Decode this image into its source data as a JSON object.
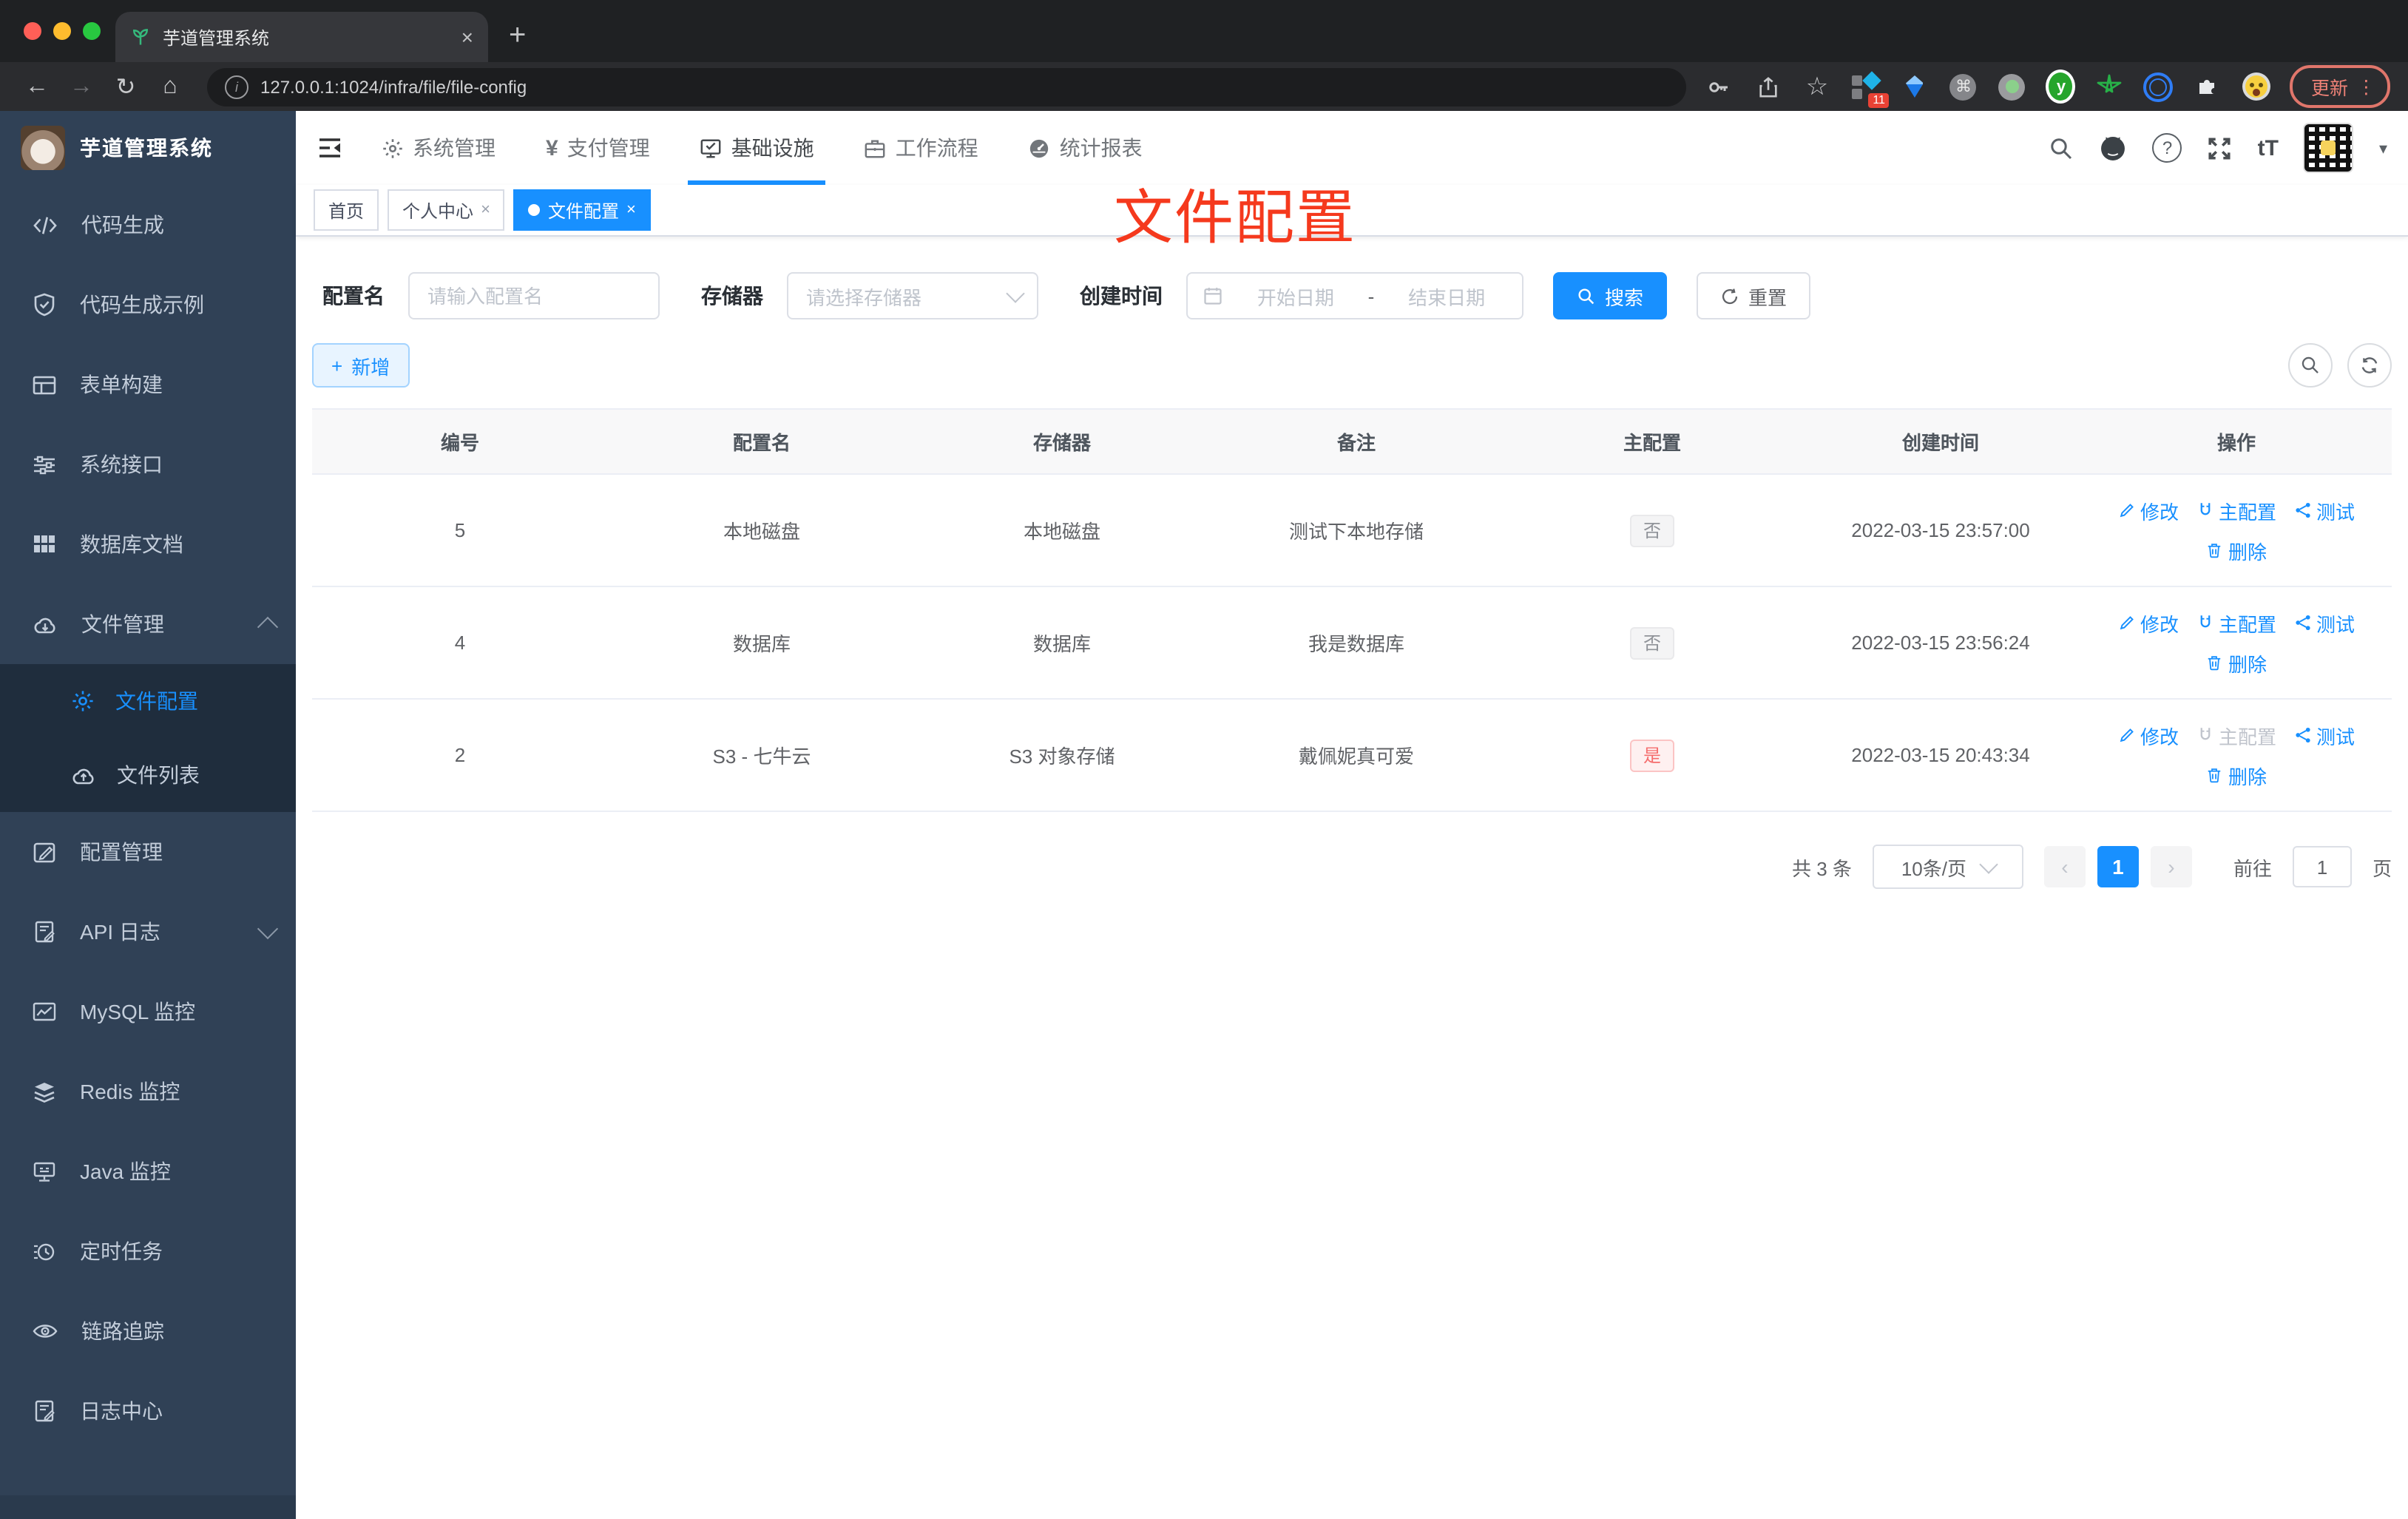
{
  "browser": {
    "tab_title": "芋道管理系统",
    "url": "127.0.0.1:1024/infra/file/file-config",
    "update_label": "更新",
    "ext_badge": "11",
    "ext_y": "y"
  },
  "icons": {
    "back": "←",
    "forward": "→",
    "reload": "↻",
    "home": "⌂",
    "star": "☆",
    "command": "⌘",
    "info": "i",
    "question": "?",
    "font_resize": "tT",
    "caret_down": "▾",
    "close": "×",
    "plus": "+",
    "ellipsis_v": "⋮",
    "prev": "‹",
    "next": "›"
  },
  "sidebar": {
    "title": "芋道管理系统",
    "items": [
      {
        "label": "代码生成"
      },
      {
        "label": "代码生成示例"
      },
      {
        "label": "表单构建"
      },
      {
        "label": "系统接口"
      },
      {
        "label": "数据库文档"
      },
      {
        "label": "文件管理",
        "expanded": true,
        "children": [
          {
            "label": "文件配置",
            "active": true
          },
          {
            "label": "文件列表"
          }
        ]
      },
      {
        "label": "配置管理"
      },
      {
        "label": "API 日志",
        "collapsed": true
      },
      {
        "label": "MySQL 监控"
      },
      {
        "label": "Redis 监控"
      },
      {
        "label": "Java 监控"
      },
      {
        "label": "定时任务"
      },
      {
        "label": "链路追踪"
      },
      {
        "label": "日志中心"
      }
    ]
  },
  "topnav": {
    "items": [
      {
        "label": "系统管理"
      },
      {
        "label": "支付管理"
      },
      {
        "label": "基础设施",
        "active": true
      },
      {
        "label": "工作流程"
      },
      {
        "label": "统计报表"
      }
    ]
  },
  "tags": {
    "items": [
      {
        "label": "首页"
      },
      {
        "label": "个人中心",
        "closable": true
      },
      {
        "label": "文件配置",
        "closable": true,
        "active": true
      }
    ]
  },
  "annotation": {
    "text": "文件配置"
  },
  "filters": {
    "name_label": "配置名",
    "name_placeholder": "请输入配置名",
    "storage_label": "存储器",
    "storage_placeholder": "请选择存储器",
    "time_label": "创建时间",
    "start_placeholder": "开始日期",
    "range_separator": "-",
    "end_placeholder": "结束日期",
    "search_label": "搜索",
    "reset_label": "重置"
  },
  "toolbar": {
    "add_label": "新增"
  },
  "table": {
    "headers": [
      "编号",
      "配置名",
      "存储器",
      "备注",
      "主配置",
      "创建时间",
      "操作"
    ],
    "actions": {
      "edit": "修改",
      "master": "主配置",
      "test": "测试",
      "del": "删除"
    },
    "rows": [
      {
        "id": "5",
        "name": "本地磁盘",
        "storage": "本地磁盘",
        "remark": "测试下本地存储",
        "primary": "否",
        "primary_type": "info",
        "created": "2022-03-15 23:57:00",
        "master_disabled": false
      },
      {
        "id": "4",
        "name": "数据库",
        "storage": "数据库",
        "remark": "我是数据库",
        "primary": "否",
        "primary_type": "info",
        "created": "2022-03-15 23:56:24",
        "master_disabled": false
      },
      {
        "id": "2",
        "name": "S3 - 七牛云",
        "storage": "S3 对象存储",
        "remark": "戴佩妮真可爱",
        "primary": "是",
        "primary_type": "danger",
        "created": "2022-03-15 20:43:34",
        "master_disabled": true
      }
    ]
  },
  "pagination": {
    "total": "共 3 条",
    "size": "10条/页",
    "page": "1",
    "goto_label": "前往",
    "goto_value": "1",
    "unit": "页"
  },
  "colors": {
    "primary": "#1890ff",
    "annotation_red": "#f5391d",
    "sidebar_bg": "#304156",
    "submenu_bg": "#1f2d3d",
    "danger": "#f56c6c",
    "traffic_red": "#ff5f57",
    "traffic_yellow": "#febc2e",
    "traffic_green": "#28c840"
  }
}
